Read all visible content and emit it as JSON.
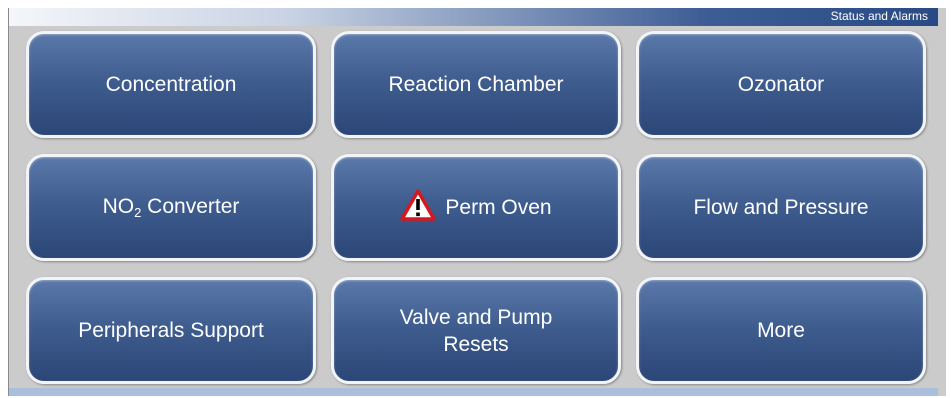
{
  "header": {
    "title": "Status and Alarms"
  },
  "buttons": {
    "concentration": "Concentration",
    "reaction_chamber": "Reaction Chamber",
    "ozonator": "Ozonator",
    "no2_prefix": "NO",
    "no2_sub": "2",
    "no2_suffix": " Converter",
    "perm_oven": "Perm Oven",
    "perm_oven_alert_icon": "warning-triangle",
    "flow_pressure": "Flow and Pressure",
    "peripherals": "Peripherals Support",
    "valve_line1": "Valve and Pump",
    "valve_line2": "Resets",
    "more": "More"
  },
  "colors": {
    "button": "#3f5d8f",
    "background": "#cbcbcb",
    "alert": "#d6181e"
  }
}
